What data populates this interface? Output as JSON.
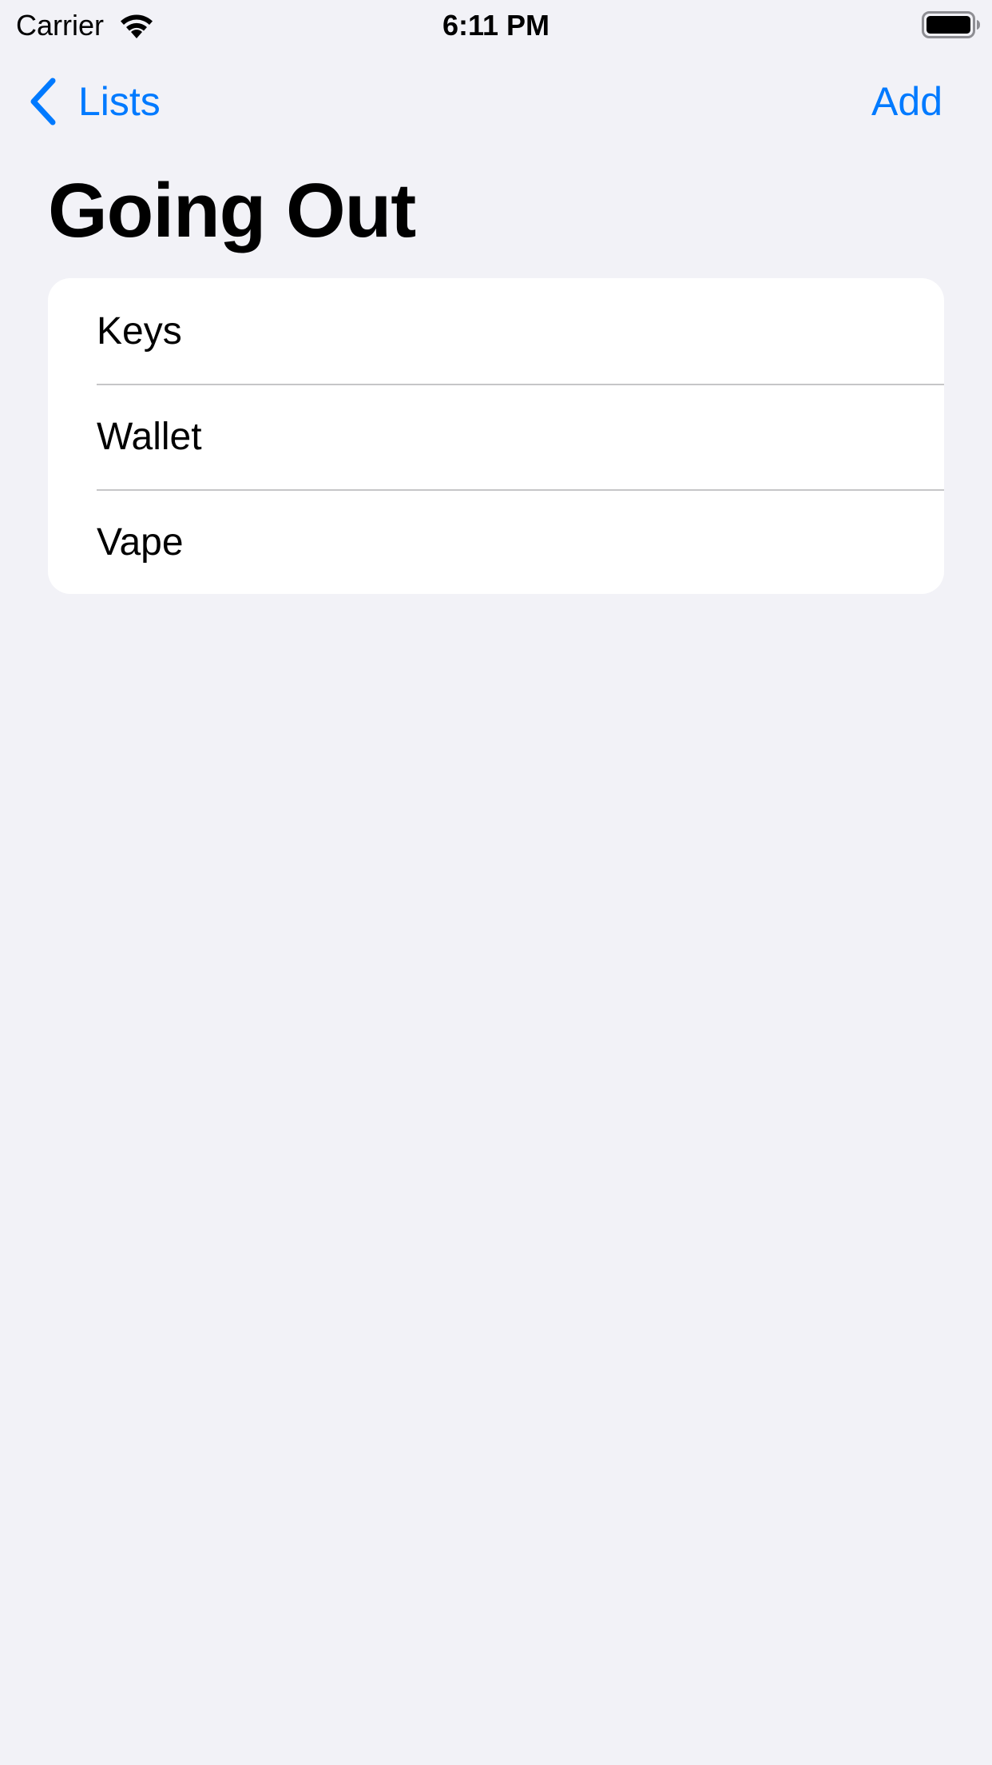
{
  "status_bar": {
    "carrier": "Carrier",
    "time": "6:11 PM",
    "wifi_icon": "wifi-icon",
    "battery_icon": "battery-full-icon"
  },
  "nav": {
    "back_label": "Lists",
    "back_icon": "chevron-left-icon",
    "add_label": "Add",
    "accent_color": "#007aff"
  },
  "page": {
    "title": "Going Out",
    "background_color": "#f2f2f7"
  },
  "list": {
    "items": [
      {
        "label": "Keys"
      },
      {
        "label": "Wallet"
      },
      {
        "label": "Vape"
      }
    ]
  }
}
